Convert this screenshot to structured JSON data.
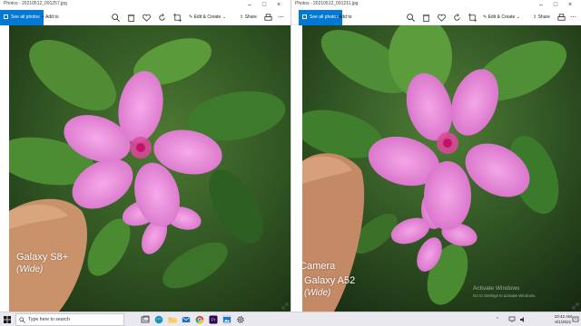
{
  "left_window": {
    "title": "Photos - 20210512_091257.jpg",
    "toolbar": {
      "see_all_label": "See all photos",
      "add_to_label": "Add to",
      "edit_create_label": "Edit & Create",
      "share_label": "Share"
    },
    "caption": {
      "line1": "Galaxy S8+",
      "line2": "(Wide)"
    }
  },
  "right_window": {
    "title": "Photos - 20210512_091211.jpg",
    "toolbar": {
      "see_all_label": "See all photos",
      "add_to_label": "Add to",
      "edit_create_label": "Edit & Create",
      "share_label": "Share"
    },
    "caption": {
      "overlap_text": "d Camera",
      "line1": "Galaxy A52",
      "line2": "(Wide)"
    },
    "watermark": {
      "line1": "Activate Windows",
      "line2": "Go to Settings to activate Windows."
    }
  },
  "taskbar": {
    "search_placeholder": "Type here to search",
    "time": "10:42 AM",
    "date": "6/1/2021"
  },
  "colors": {
    "accent": "#0078d4",
    "petal": "#e47fd6",
    "petal_center": "#d6156f",
    "leaf": "#3f7d2e"
  }
}
